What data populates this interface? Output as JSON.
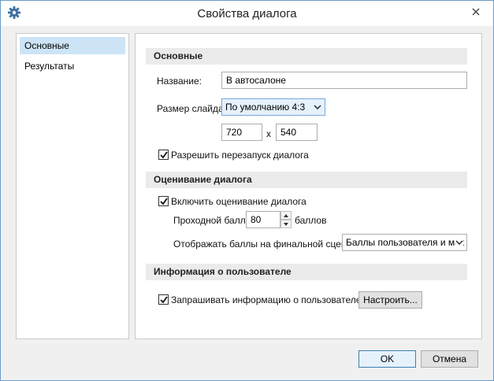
{
  "window": {
    "title": "Свойства диалога"
  },
  "nav": {
    "items": [
      {
        "label": "Основные",
        "selected": true
      },
      {
        "label": "Результаты",
        "selected": false
      }
    ]
  },
  "sections": {
    "main": {
      "header": "Основные",
      "name_label": "Название:",
      "name_value": "В автосалоне",
      "slide_size_label": "Размер слайда:",
      "slide_size_value": "По умолчанию 4:3",
      "width_value": "720",
      "x_sep": "x",
      "height_value": "540",
      "allow_restart_label": "Разрешить перезапуск диалога",
      "allow_restart_checked": true
    },
    "scoring": {
      "header": "Оценивание диалога",
      "enable_label": "Включить оценивание диалога",
      "enable_checked": true,
      "passing_label": "Проходной балл:",
      "passing_value": "80",
      "passing_unit": "баллов",
      "display_label": "Отображать баллы на финальной сцене:",
      "display_value": "Баллы пользователя и мак"
    },
    "user_info": {
      "header": "Информация о пользователе",
      "ask_label": "Запрашивать информацию о пользователе",
      "ask_checked": true,
      "configure_label": "Настроить..."
    }
  },
  "footer": {
    "ok_label": "OK",
    "cancel_label": "Отмена"
  },
  "icons": {
    "app": "gear-icon",
    "close": "close-icon",
    "caret": "chevron-down-icon"
  },
  "colors": {
    "accent": "#3c7fb1",
    "selected_nav": "#cde4f7",
    "section_bg": "#ebebeb"
  }
}
